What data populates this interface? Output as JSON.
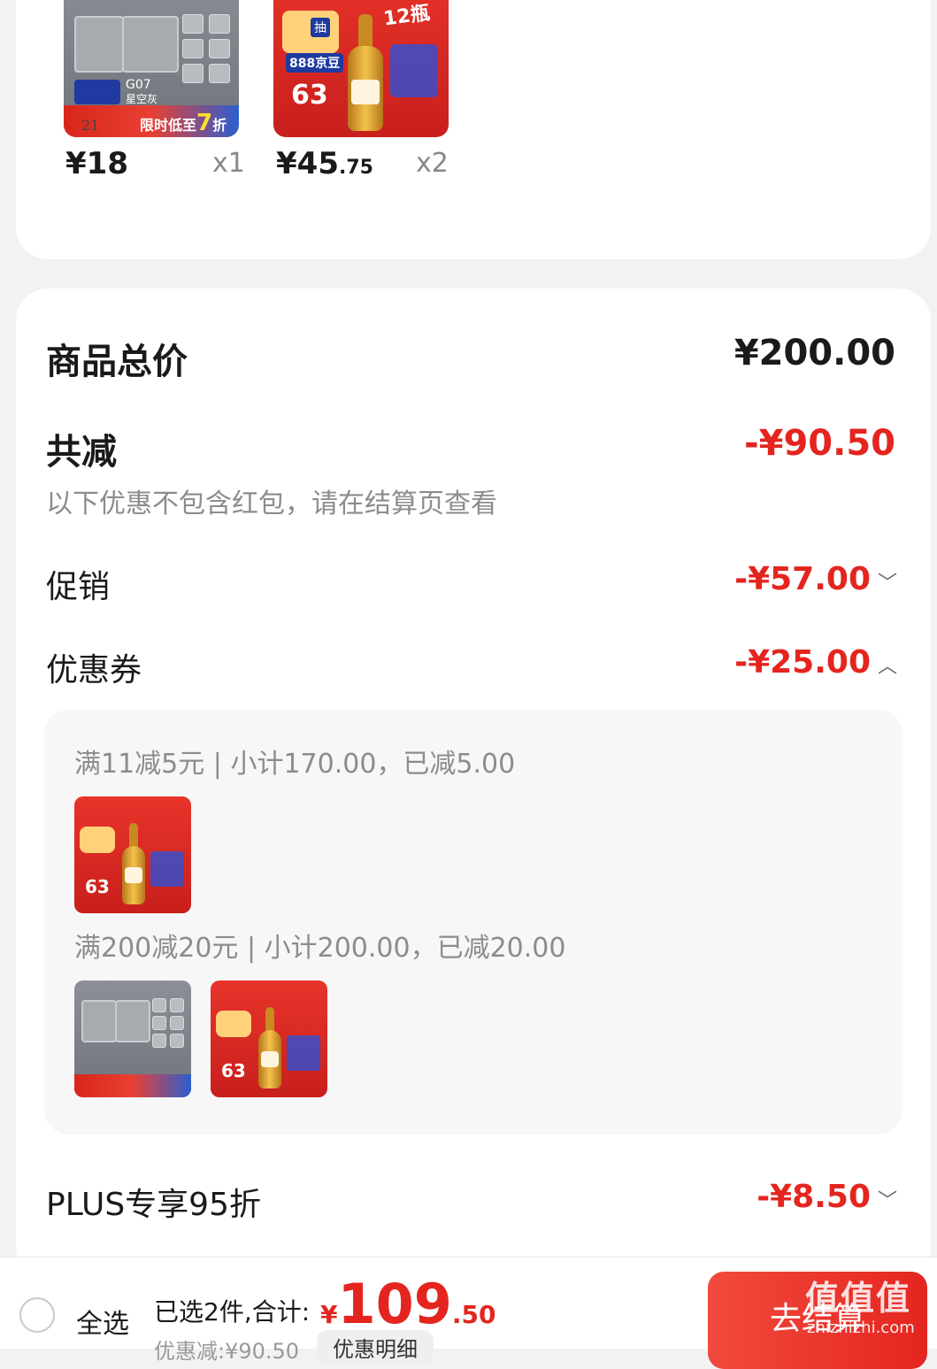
{
  "cart_items": [
    {
      "price": "¥18",
      "price_decimal": "",
      "qty": "x1",
      "badge_top": "G07",
      "badge_sub": "星空灰",
      "promo": "限时低至",
      "promo_num": "7",
      "promo_unit": "折",
      "strip_price": "21"
    },
    {
      "price": "¥45",
      "price_decimal": ".75",
      "qty": "x2",
      "badge_top": "888京豆",
      "badge_sub": "抽",
      "promo_big": "63",
      "promo_tag": "12瓶"
    }
  ],
  "summary": {
    "total_label": "商品总价",
    "total_value": "¥200.00",
    "reduce_label": "共减",
    "reduce_value": "-¥90.50",
    "reduce_note": "以下优惠不包含红包，请在结算页查看",
    "promo_label": "促销",
    "promo_value": "-¥57.00",
    "coupon_label": "优惠券",
    "coupon_value": "-¥25.00",
    "plus_label": "PLUS专享95折",
    "plus_value": "-¥8.50"
  },
  "coupons": [
    {
      "text": "满11减5元 | 小计170.00，已减5.00"
    },
    {
      "text": "满200减20元 | 小计200.00，已减20.00"
    }
  ],
  "bottom_bar": {
    "select_all": "全选",
    "selected_text": "已选2件,合计:",
    "currency": "¥",
    "total_int": "109",
    "total_dec": ".50",
    "discount_text": "优惠减:¥90.50",
    "detail_button": "优惠明细",
    "checkout_button": "去结算"
  },
  "watermark": {
    "text": "值值值",
    "sub": "zhizhizhi.com"
  },
  "colors": {
    "accent_red": "#e4251f",
    "text_dark": "#1a1a1a",
    "text_gray": "#8c8c8c",
    "page_bg": "#f2f2f2"
  }
}
